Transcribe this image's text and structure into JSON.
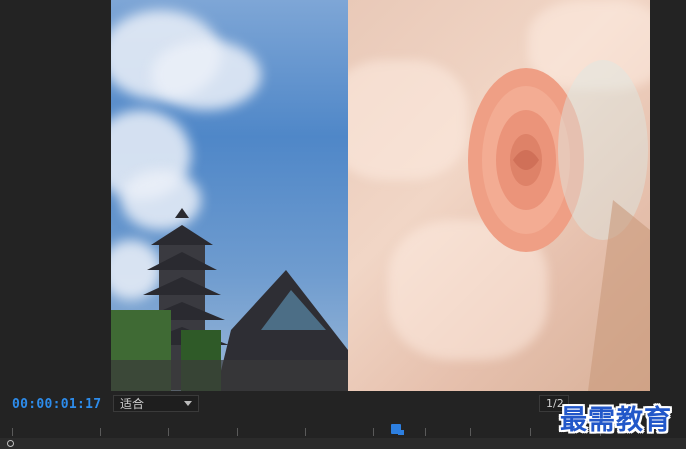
{
  "program_monitor": {
    "timecode": "00:00:01:17",
    "fit_label": "适合",
    "resolution_label": "1/2"
  },
  "watermark": {
    "text": "最需教育"
  },
  "colors": {
    "timecode": "#2d8ceb",
    "playhead": "#2d7fe0",
    "watermark": "#2257c9",
    "background": "#232323"
  }
}
